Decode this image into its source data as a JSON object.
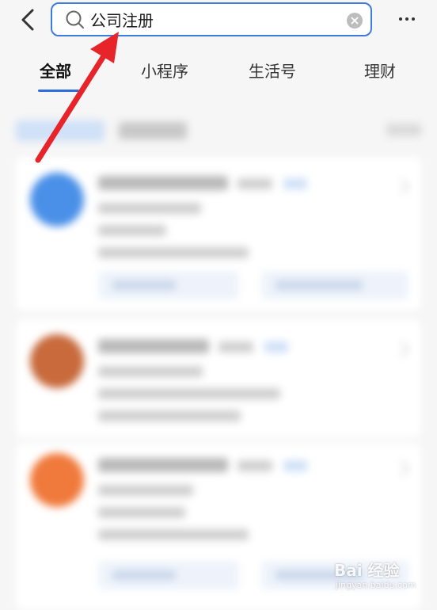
{
  "search": {
    "query": "公司注册"
  },
  "tabs": [
    {
      "label": "全部",
      "active": true
    },
    {
      "label": "小程序",
      "active": false
    },
    {
      "label": "生活号",
      "active": false
    },
    {
      "label": "理财",
      "active": false
    }
  ],
  "icons": {
    "back": "chevron-left-icon",
    "search": "search-icon",
    "clear": "clear-icon",
    "more": "more-icon"
  },
  "colors": {
    "accent": "#2f6fdc",
    "search_border": "#3d7be0",
    "arrow": "#e8242b",
    "avatar_1": "#4a90e8",
    "avatar_2": "#c86a3c",
    "avatar_3": "#f07a3c"
  },
  "watermark": {
    "brand": "Bai 经验",
    "url": "jingyan.baidu.com"
  }
}
